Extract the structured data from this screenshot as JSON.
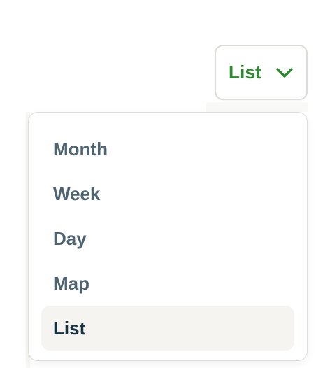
{
  "view_selector": {
    "current_label": "List",
    "icon": "chevron-down-icon",
    "accent_color": "#2c8a2e"
  },
  "view_menu": {
    "items": [
      {
        "label": "Month",
        "selected": false
      },
      {
        "label": "Week",
        "selected": false
      },
      {
        "label": "Day",
        "selected": false
      },
      {
        "label": "Map",
        "selected": false
      },
      {
        "label": "List",
        "selected": true
      }
    ],
    "text_color": "#4e6470",
    "selected_text_color": "#16313f",
    "selected_bg_color": "#f5f4f1"
  }
}
